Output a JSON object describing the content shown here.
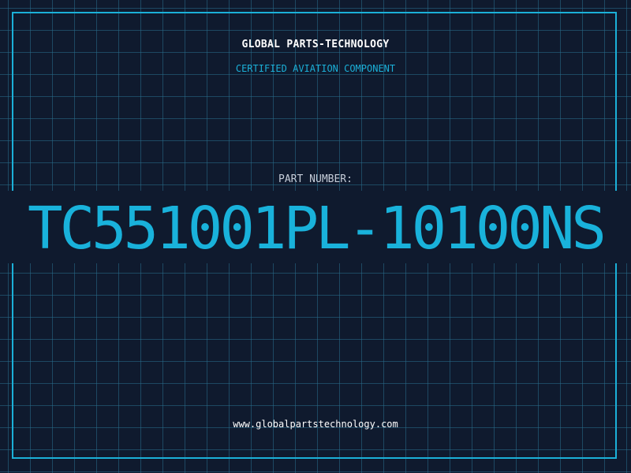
{
  "header": {
    "company": "GLOBAL PARTS-TECHNOLOGY",
    "tagline": "CERTIFIED AVIATION COMPONENT"
  },
  "part": {
    "label": "PART NUMBER:",
    "number": "TC551001PL-10100NS"
  },
  "footer": {
    "url": "www.globalpartstechnology.com"
  },
  "colors": {
    "background": "#0f1a2e",
    "grid": "#286e8c",
    "accent": "#1bb0d8",
    "text": "#ffffff",
    "label": "#c5ccd8"
  }
}
